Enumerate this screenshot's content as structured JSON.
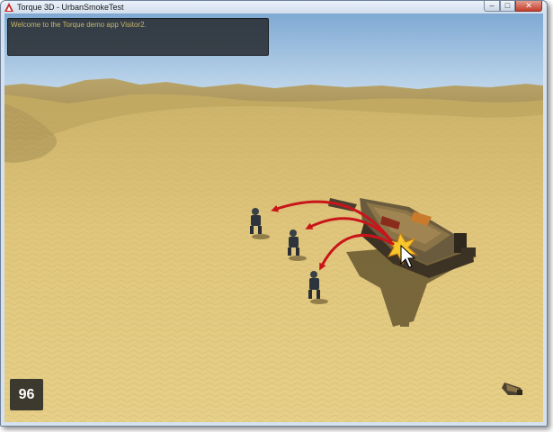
{
  "window": {
    "title": "Torque 3D - UrbanSmokeTest",
    "icon": "torque-logo-icon",
    "controls": {
      "minimize": "minimize-icon",
      "maximize": "maximize-icon",
      "close": "close-icon"
    }
  },
  "console": {
    "message": "Welcome to the Torque demo app Visitor2."
  },
  "hud": {
    "fps": "96"
  },
  "scene": {
    "sky_color": "#a9cbe8",
    "sand_color": "#d8bf74",
    "arrow_color": "#c8141a",
    "cursor": "mouse-pointer-icon"
  }
}
